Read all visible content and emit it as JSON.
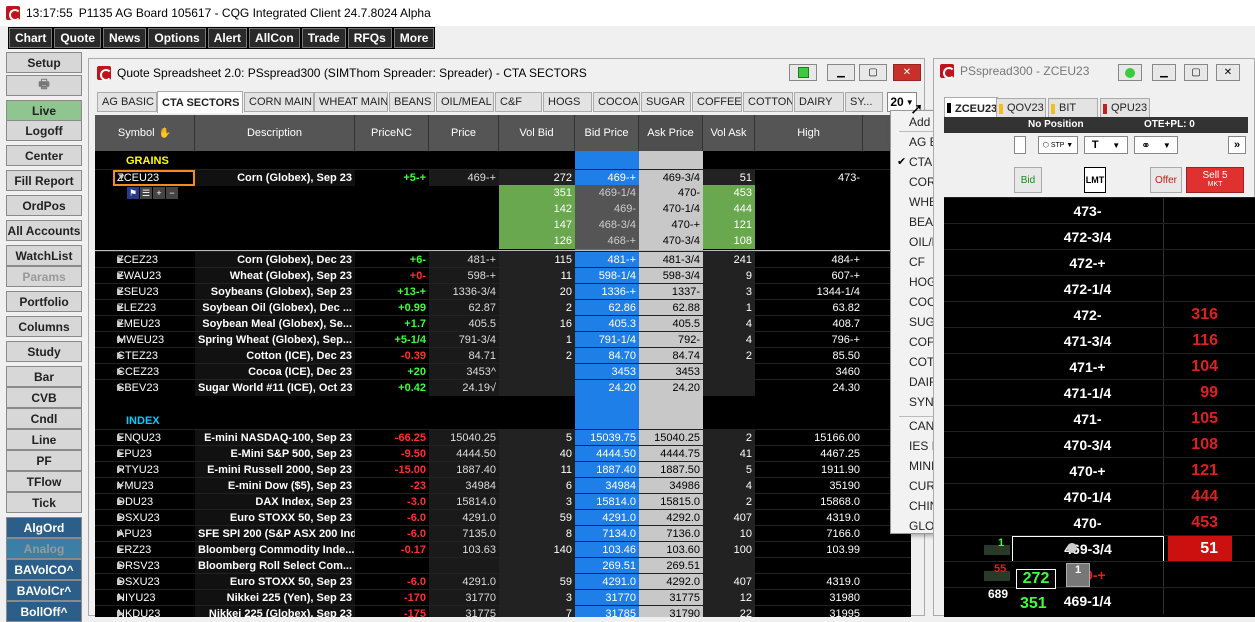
{
  "window": {
    "time": "13:17:55",
    "title": "P1135 AG Board   105617 - CQG Integrated Client 24.7.8024 Alpha"
  },
  "menu": [
    "Chart",
    "Quote",
    "News",
    "Options",
    "Alert",
    "AllCon",
    "Trade",
    "RFQs",
    "More"
  ],
  "leftbar": {
    "items": [
      {
        "label": "Setup",
        "style": "plain"
      },
      {
        "label": "",
        "style": "print"
      },
      {
        "label": "Live",
        "style": "green"
      },
      {
        "label": "Logoff",
        "style": "plain"
      },
      {
        "label": "Center",
        "style": "plain"
      },
      {
        "label": "Fill Report",
        "style": "plain"
      },
      {
        "label": "OrdPos",
        "style": "plain"
      },
      {
        "label": "All Accounts",
        "style": "plain"
      },
      {
        "label": "WatchList",
        "style": "plain"
      },
      {
        "label": "Params",
        "style": "dim"
      },
      {
        "label": "Portfolio",
        "style": "plain"
      },
      {
        "label": "Columns",
        "style": "plain"
      },
      {
        "label": "Study",
        "style": "plain"
      },
      {
        "label": "Bar",
        "style": "plain"
      },
      {
        "label": "CVB",
        "style": "plain"
      },
      {
        "label": "Cndl",
        "style": "plain"
      },
      {
        "label": "Line",
        "style": "plain"
      },
      {
        "label": "PF",
        "style": "plain"
      },
      {
        "label": "TFlow",
        "style": "plain"
      },
      {
        "label": "Tick",
        "style": "plain"
      },
      {
        "label": "AlgOrd",
        "style": "teal"
      },
      {
        "label": "Analog",
        "style": "teal2dim"
      },
      {
        "label": "BAVolCO^",
        "style": "teal"
      },
      {
        "label": "BAVolCr^",
        "style": "teal"
      },
      {
        "label": "BollOff^",
        "style": "teal"
      }
    ]
  },
  "quote_window": {
    "title": "Quote Spreadsheet 2.0: PSspread300 (SIMThom Spreader: Spreader) - CTA SECTORS",
    "tabs": [
      "AG BASIC",
      "CTA SECTORS",
      "CORN MAIN",
      "WHEAT MAIN",
      "BEANS",
      "OIL/MEAL",
      "C&F",
      "HOGS",
      "COCOA",
      "SUGAR",
      "COFFEE",
      "COTTON",
      "DAIRY",
      "SY..."
    ],
    "active_tab": "CTA SECTORS",
    "tab_count": "20",
    "columns": [
      "Symbol",
      "Description",
      "PriceNC",
      "Price",
      "Vol Bid",
      "Bid Price",
      "Ask Price",
      "Vol Ask",
      "High"
    ],
    "sections": {
      "grains": "GRAINS",
      "index": "INDEX"
    },
    "expanded": {
      "symbol": "ZCEU23",
      "description": "Corn (Globex), Sep 23",
      "pricenc": "+5-+",
      "price": "469-+",
      "volbid": "272",
      "bid": "469-+",
      "ask": "469-3/4",
      "volask": "51",
      "high": "473-",
      "depth": [
        {
          "volbid": "351",
          "bid": "469-1/4",
          "ask": "470-",
          "volask": "453"
        },
        {
          "volbid": "142",
          "bid": "469-",
          "ask": "470-1/4",
          "volask": "444"
        },
        {
          "volbid": "147",
          "bid": "468-3/4",
          "ask": "470-+",
          "volask": "121"
        },
        {
          "volbid": "126",
          "bid": "468-+",
          "ask": "470-3/4",
          "volask": "108"
        }
      ]
    },
    "rows": [
      {
        "symbol": "ZCEZ23",
        "description": "Corn (Globex), Dec 23",
        "pricenc": "+6-",
        "price": "481-+",
        "volbid": "115",
        "bid": "481-+",
        "ask": "481-3/4",
        "volask": "241",
        "high": "484-+",
        "dir": "up"
      },
      {
        "symbol": "ZWAU23",
        "description": "Wheat (Globex), Sep 23",
        "pricenc": "+0-",
        "price": "598-+",
        "volbid": "11",
        "bid": "598-1/4",
        "ask": "598-3/4",
        "volask": "9",
        "high": "607-+",
        "dir": "down"
      },
      {
        "symbol": "ZSEU23",
        "description": "Soybeans (Globex), Sep 23",
        "pricenc": "+13-+",
        "price": "1336-3/4",
        "volbid": "20",
        "bid": "1336-+",
        "ask": "1337-",
        "volask": "3",
        "high": "1344-1/4",
        "dir": "up"
      },
      {
        "symbol": "ZLEZ23",
        "description": "Soybean Oil (Globex), Dec ...",
        "pricenc": "+0.99",
        "price": "62.87",
        "volbid": "2",
        "bid": "62.86",
        "ask": "62.88",
        "volask": "1",
        "high": "63.82",
        "dir": "up"
      },
      {
        "symbol": "ZMEU23",
        "description": "Soybean Meal (Globex), Se...",
        "pricenc": "+1.7",
        "price": "405.5",
        "volbid": "16",
        "bid": "405.3",
        "ask": "405.5",
        "volask": "4",
        "high": "408.7",
        "dir": "up"
      },
      {
        "symbol": "MWEU23",
        "description": "Spring Wheat (Globex), Sep...",
        "pricenc": "+5-1/4",
        "price": "791-3/4",
        "volbid": "1",
        "bid": "791-1/4",
        "ask": "792-",
        "volask": "4",
        "high": "796-+",
        "dir": "up"
      },
      {
        "symbol": "CTEZ23",
        "description": "Cotton (ICE), Dec 23",
        "pricenc": "-0.39",
        "price": "84.71",
        "volbid": "2",
        "bid": "84.70",
        "ask": "84.74",
        "volask": "2",
        "high": "85.50",
        "dir": "down"
      },
      {
        "symbol": "CCEZ23",
        "description": "Cocoa (ICE), Dec 23",
        "pricenc": "+20",
        "price": "3453^",
        "volbid": "",
        "bid": "3453",
        "ask": "3453",
        "volask": "",
        "high": "3460",
        "dir": "up"
      },
      {
        "symbol": "SBEV23",
        "description": "Sugar World #11 (ICE), Oct 23",
        "pricenc": "+0.42",
        "price": "24.19√",
        "volbid": "",
        "bid": "24.20",
        "ask": "24.20",
        "volask": "",
        "high": "24.30",
        "dir": "up"
      }
    ],
    "index_rows": [
      {
        "symbol": "ENQU23",
        "description": "E-mini NASDAQ-100, Sep 23",
        "pricenc": "-66.25",
        "price": "15040.25",
        "volbid": "5",
        "bid": "15039.75",
        "ask": "15040.25",
        "volask": "2",
        "high": "15166.00",
        "dir": "down"
      },
      {
        "symbol": "EPU23",
        "description": "E-Mini S&P 500, Sep 23",
        "pricenc": "-9.50",
        "price": "4444.50",
        "volbid": "40",
        "bid": "4444.50",
        "ask": "4444.75",
        "volask": "41",
        "high": "4467.25",
        "dir": "down"
      },
      {
        "symbol": "RTYU23",
        "description": "E-mini Russell 2000, Sep 23",
        "pricenc": "-15.00",
        "price": "1887.40",
        "volbid": "11",
        "bid": "1887.40",
        "ask": "1887.50",
        "volask": "5",
        "high": "1911.90",
        "dir": "down"
      },
      {
        "symbol": "YMU23",
        "description": "E-mini Dow ($5), Sep 23",
        "pricenc": "-23",
        "price": "34984",
        "volbid": "6",
        "bid": "34984",
        "ask": "34986",
        "volask": "4",
        "high": "35190",
        "dir": "down"
      },
      {
        "symbol": "DDU23",
        "description": "DAX Index, Sep 23",
        "pricenc": "-3.0",
        "price": "15814.0",
        "volbid": "3",
        "bid": "15814.0",
        "ask": "15815.0",
        "volask": "2",
        "high": "15868.0",
        "dir": "down"
      },
      {
        "symbol": "DSXU23",
        "description": "Euro STOXX 50, Sep 23",
        "pricenc": "-6.0",
        "price": "4291.0",
        "volbid": "59",
        "bid": "4291.0",
        "ask": "4292.0",
        "volask": "407",
        "high": "4319.0",
        "dir": "down"
      },
      {
        "symbol": "APU23",
        "description": "SFE SPI 200 (S&P ASX 200 Ind...",
        "pricenc": "-6.0",
        "price": "7135.0",
        "volbid": "8",
        "bid": "7134.0",
        "ask": "7136.0",
        "volask": "10",
        "high": "7166.0",
        "dir": "down"
      },
      {
        "symbol": "ERZ23",
        "description": "Bloomberg Commodity Inde...",
        "pricenc": "-0.17",
        "price": "103.63",
        "volbid": "140",
        "bid": "103.46",
        "ask": "103.60",
        "volask": "100",
        "high": "103.99",
        "dir": "down"
      },
      {
        "symbol": "DRSV23",
        "description": "Bloomberg Roll Select Com...",
        "pricenc": "",
        "price": "",
        "volbid": "",
        "bid": "269.51",
        "ask": "269.51",
        "volask": "",
        "high": "",
        "dir": "none"
      },
      {
        "symbol": "DSXU23",
        "description": "Euro STOXX 50, Sep 23",
        "pricenc": "-6.0",
        "price": "4291.0",
        "volbid": "59",
        "bid": "4291.0",
        "ask": "4292.0",
        "volask": "407",
        "high": "4319.0",
        "dir": "down"
      },
      {
        "symbol": "NIYU23",
        "description": "Nikkei 225 (Yen), Sep 23",
        "pricenc": "-170",
        "price": "31770",
        "volbid": "3",
        "bid": "31770",
        "ask": "31775",
        "volask": "12",
        "high": "31980",
        "dir": "down"
      },
      {
        "symbol": "NKDU23",
        "description": "Nikkei 225 (Globex), Sep 23",
        "pricenc": "-175",
        "price": "31775",
        "volbid": "7",
        "bid": "31785",
        "ask": "31790",
        "volask": "22",
        "high": "31995",
        "dir": "down"
      }
    ]
  },
  "dropdown": {
    "add": "Add New Tab",
    "items": [
      "AG BASIC",
      "CTA SECTORS",
      "CORN MAIN",
      "WHEAT MAIN",
      "BEANS",
      "OIL/MEAL",
      "CF",
      "HOGS",
      "COCOA",
      "SUGAR",
      "COFFEE",
      "COTTON",
      "DAIRY",
      "SYN SPREADS",
      "CAN/PALM",
      "IES ICS CRH",
      "MINI GRAIN",
      "CURRENCY",
      "CHINA",
      "GLOBAL/MISC"
    ],
    "checked": "CTA SECTORS"
  },
  "dom_window": {
    "title": "PSspread300 - ZCEU23",
    "tabs": [
      "ZCEU23",
      "QOV23",
      "BIT",
      "QPU23"
    ],
    "position": "No Position",
    "ote": "OTE+PL: 0",
    "bid_button": "Bid",
    "lmt": "LMT",
    "offer_button": "Offer",
    "sell_button": "Sell 5",
    "sell_sub": "MKT",
    "order_type_t": "T",
    "ladder": [
      {
        "price": "473-",
        "ask": ""
      },
      {
        "price": "472-3/4",
        "ask": ""
      },
      {
        "price": "472-+",
        "ask": ""
      },
      {
        "price": "472-1/4",
        "ask": ""
      },
      {
        "price": "472-",
        "ask": "316"
      },
      {
        "price": "471-3/4",
        "ask": "116"
      },
      {
        "price": "471-+",
        "ask": "104"
      },
      {
        "price": "471-1/4",
        "ask": "99"
      },
      {
        "price": "471-",
        "ask": "105"
      },
      {
        "price": "470-3/4",
        "ask": "108"
      },
      {
        "price": "470-+",
        "ask": "121"
      },
      {
        "price": "470-1/4",
        "ask": "444"
      },
      {
        "price": "470-",
        "ask": "453"
      },
      {
        "price": "469-3/4",
        "ask": "51"
      },
      {
        "price": "469-+",
        "ask": ""
      },
      {
        "price": "469-1/4",
        "ask": ""
      }
    ],
    "left_vals": {
      "small": "1",
      "red": "55",
      "bid_green": "272",
      "bid_green2": "351",
      "white": "689",
      "order_qty": "1"
    }
  },
  "colors": {
    "bid_blue": "#1e7fe8",
    "ask_grey": "#c8c8c8",
    "up": "#3cff3c",
    "down": "#ff3030",
    "section_yellow": "#ffff00",
    "section_cyan": "#00ccff"
  }
}
